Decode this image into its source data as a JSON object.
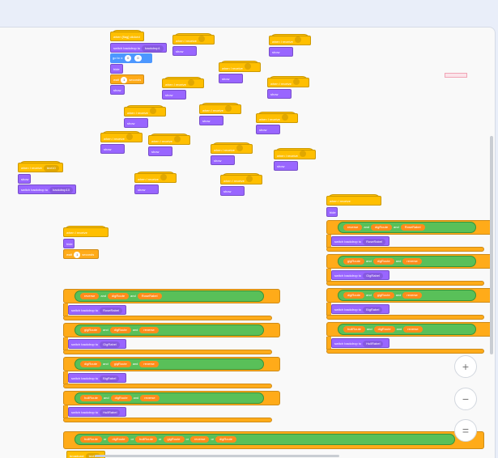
{
  "colors": {
    "events": "#ffbf00",
    "looks": "#9966ff",
    "control": "#ffab19",
    "operators": "#59c059",
    "variables": "#ff8c1a",
    "sensing": "#5cb1d6"
  },
  "blocks": {
    "flag_hat": "when [flag] clicked",
    "switch_backdrop": "switch backdrop to",
    "go_to_x": "go to x:",
    "hide": "hide",
    "show": "show",
    "wait": "wait",
    "seconds": "seconds",
    "when_clicked": "when I receive",
    "wait_secs": "wait",
    "if": "if",
    "then": "then",
    "and": "and",
    "or": "or",
    "broadcast": "broadcast"
  },
  "values": {
    "backdrop1": "backdrop1",
    "x": "0",
    "y": "0",
    "wait1": "1",
    "wait2": "1",
    "backdrop1b": "backdrop10",
    "broadcast1": "text10"
  },
  "vars": {
    "reverse": "reverse",
    "big": "bigRoute",
    "hue": "hueRoute",
    "huff": "hullRoute",
    "dig": "digRoute",
    "gig": "gigRoute",
    "rose": "RoseRabel",
    "gigrabel": "GigRabel",
    "bigrabel": "BigRabel",
    "hullrabel": "HullRabel"
  },
  "zoom": {
    "in": "+",
    "out": "−",
    "reset": "="
  }
}
